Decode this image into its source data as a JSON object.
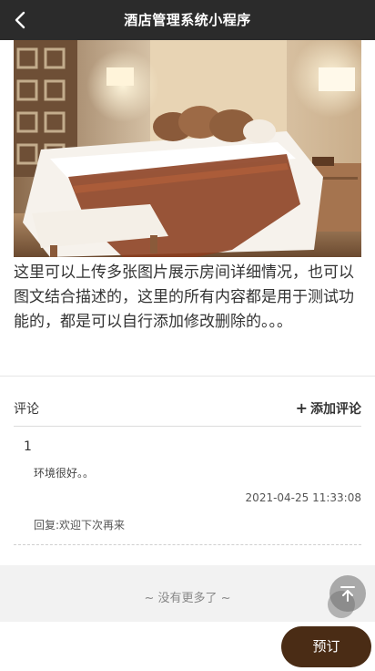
{
  "navbar": {
    "back_icon": "chevron-left-icon",
    "title": "酒店管理系统小程序"
  },
  "room": {
    "description": "这里可以上传多张图片展示房间详细情况，也可以图文结合描述的，这里的所有内容都是用于测试功能的，都是可以自行添加修改删除的。。。"
  },
  "comments": {
    "title": "评论",
    "add_label": "添加评论",
    "add_icon": "plus-icon",
    "items": [
      {
        "user": "1",
        "text": "环境很好。。",
        "time": "2021-04-25 11:33:08",
        "reply": "回复:欢迎下次再来"
      }
    ]
  },
  "footer": {
    "no_more": "~ 没有更多了 ~",
    "scroll_top_icon": "arrow-up-to-top-icon"
  },
  "actions": {
    "book_label": "预订",
    "book_color": "#4a2c15"
  },
  "colors": {
    "navbar_bg": "#2b2b2b",
    "footer_bg": "#f2f2f2"
  }
}
